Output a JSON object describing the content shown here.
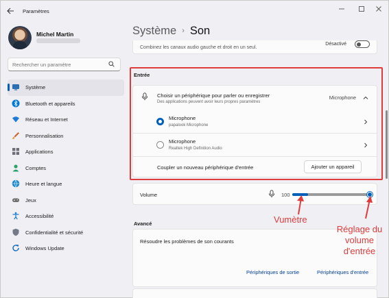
{
  "window": {
    "app_title": "Paramètres",
    "back_icon": "back-arrow-icon",
    "controls": [
      "minimize-icon",
      "maximize-icon",
      "close-icon"
    ]
  },
  "user": {
    "name": "Michel Martin"
  },
  "search": {
    "placeholder": "Rechercher un paramètre",
    "icon": "search-icon"
  },
  "nav": {
    "items": [
      {
        "label": "Système",
        "icon": "system-icon",
        "color": "#2b6fb0",
        "active": true
      },
      {
        "label": "Bluetooth et appareils",
        "icon": "bluetooth-icon",
        "color": "#0078d4",
        "active": false
      },
      {
        "label": "Réseau et Internet",
        "icon": "network-icon",
        "color": "#1f7ad6",
        "active": false
      },
      {
        "label": "Personnalisation",
        "icon": "brush-icon",
        "color": "#c9652e",
        "active": false
      },
      {
        "label": "Applications",
        "icon": "apps-icon",
        "color": "#6e6e78",
        "active": false
      },
      {
        "label": "Comptes",
        "icon": "accounts-icon",
        "color": "#2aa36b",
        "active": false
      },
      {
        "label": "Heure et langue",
        "icon": "globe-clock-icon",
        "color": "#1a86c8",
        "active": false
      },
      {
        "label": "Jeux",
        "icon": "gamepad-icon",
        "color": "#6d6d6d",
        "active": false
      },
      {
        "label": "Accessibilité",
        "icon": "accessibility-icon",
        "color": "#1b7bd0",
        "active": false
      },
      {
        "label": "Confidentialité et sécurité",
        "icon": "shield-icon",
        "color": "#747b86",
        "active": false
      },
      {
        "label": "Windows Update",
        "icon": "update-icon",
        "color": "#0f6cbd",
        "active": false
      }
    ]
  },
  "breadcrumb": {
    "parent": "Système",
    "separator": "›",
    "current": "Son"
  },
  "main": {
    "truncated_text": "Combinez les canaux audio gauche et droit en un seul.",
    "mono_toggle_label": "Désactivé",
    "input_section_title": "Entrée",
    "input_select": {
      "title": "Choisir un périphérique pour parler ou enregistrer",
      "subtitle": "Des applications peuvent avoir leurs propres paramètres",
      "value": "Microphone"
    },
    "devices": [
      {
        "name": "Microphone",
        "sub": "papalook Microphone",
        "selected": true
      },
      {
        "name": "Microphone",
        "sub": "Realtek High Definition Audio",
        "selected": false
      }
    ],
    "pair": {
      "label": "Coupler un nouveau périphérique d'entrée",
      "button": "Ajouter un appareil"
    },
    "volume": {
      "label": "Volume",
      "value": "100",
      "meter_level": 0.2,
      "slider_level": 1.0
    },
    "advanced_title": "Avancé",
    "advanced": {
      "troubleshoot": "Résoudre les problèmes de son courants",
      "link_output": "Périphériques de sortie",
      "link_input": "Périphériques d'entrée"
    }
  },
  "annotations": {
    "meter": "Vumètre",
    "slider": "Réglage du volume d'entrée",
    "color": "#e03b3b"
  },
  "colors": {
    "accent": "#005fb8",
    "background": "#f0eff4",
    "card": "#fbfbfc",
    "annotation": "#e03b3b"
  }
}
